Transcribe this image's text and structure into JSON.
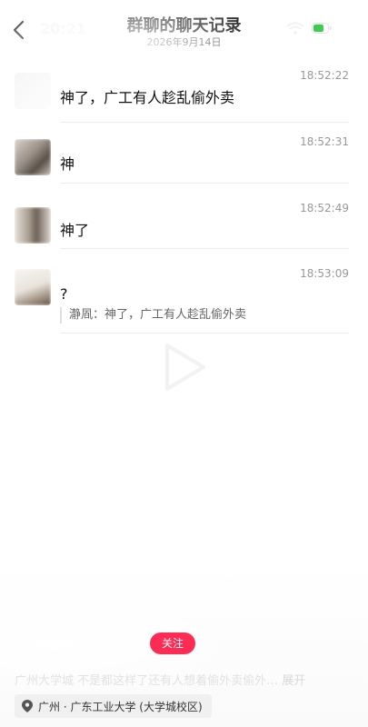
{
  "header": {
    "time": "20:21",
    "title": "群聊的聊天记录",
    "subtitle": "2026年9月14日"
  },
  "icons": {
    "back": "back-arrow-icon",
    "wifi": "wifi-icon",
    "battery": "battery-icon",
    "play": "play-icon",
    "pin": "location-pin-icon"
  },
  "messages": [
    {
      "sender": "",
      "time": "18:52:22",
      "text": "神了，广工有人趁乱偷外卖"
    },
    {
      "sender": "",
      "time": "18:52:31",
      "text": "神"
    },
    {
      "sender": "",
      "time": "18:52:49",
      "text": "神了"
    },
    {
      "sender": "",
      "time": "18:53:09",
      "text": "?",
      "quote": "瀞凮：神了，广工有人趁乱偷外卖"
    }
  ],
  "footer": {
    "follow_label": "关注",
    "caption": "广州大学城 不是都这样了还有人想着偷外卖偷外…",
    "expand_label": "展开",
    "location": "广州 · 广东工业大学 (大学城校区)"
  },
  "colors": {
    "accent": "#fe2c55",
    "battery": "#3ccf4e"
  }
}
